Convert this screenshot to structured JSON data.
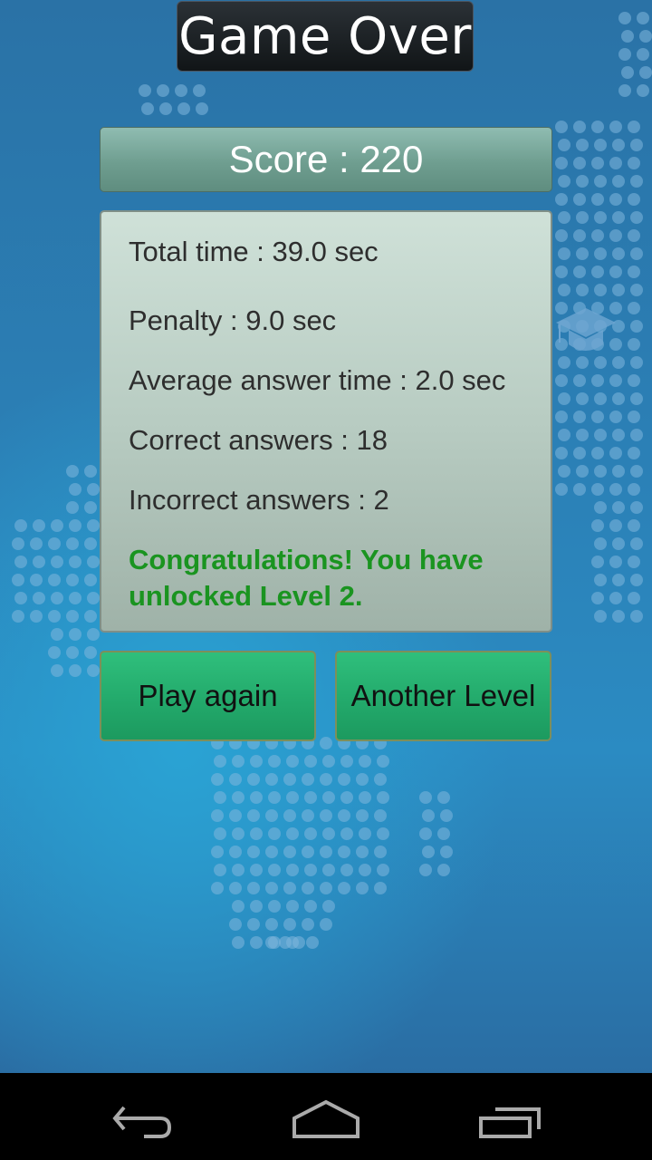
{
  "header": {
    "title": "Game Over"
  },
  "score": {
    "label": "Score : 220",
    "value": 220
  },
  "stats": {
    "total_time": "Total time : 39.0 sec",
    "penalty": "Penalty : 9.0 sec",
    "average_answer_time": "Average answer time : 2.0 sec",
    "correct_answers": "Correct answers : 18",
    "incorrect_answers": "Incorrect answers : 2",
    "message": "Congratulations! You have unlocked Level 2."
  },
  "buttons": {
    "play_again": "Play again",
    "another_level": "Another Level"
  },
  "icons": {
    "background_decoration": "graduation-cap-icon",
    "nav_back": "back-icon",
    "nav_home": "home-icon",
    "nav_recent": "recent-apps-icon"
  },
  "colors": {
    "congrats_text": "#1a9420",
    "button_green": "#22a86a",
    "score_bar": "#6f9e90",
    "background_blue": "#2b7fb5"
  }
}
